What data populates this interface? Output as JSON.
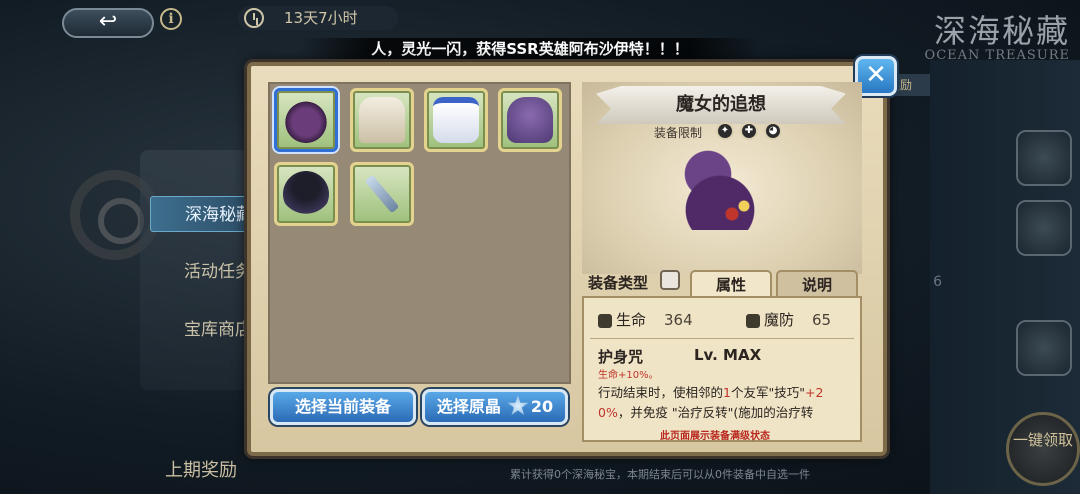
{
  "header": {
    "back_glyph": "↩",
    "info_glyph": "i",
    "timer": "13天7小时",
    "event_title_cn": "深海秘藏",
    "event_title_en": "OCEAN TREASURE"
  },
  "marquee": "人，灵光一闪，获得SSR英雄阿布沙伊特！！！",
  "background": {
    "tabs": [
      {
        "label": "深海秘藏",
        "active": true
      },
      {
        "label": "活动任务",
        "active": false
      },
      {
        "label": "宝库商店",
        "active": false
      }
    ],
    "last_reward": "上期奖励",
    "right_tab": "奖励",
    "right_number": "6",
    "one_click": "一键领取",
    "bottom_text": "累计获得0个深海秘宝，本期结束后可以从0件装备中自选一件"
  },
  "modal": {
    "header_tab": "上期奖励",
    "close_glyph": "✕",
    "inventory": [
      {
        "icon": "witch-hat-icon",
        "selected": true
      },
      {
        "icon": "white-robe-icon",
        "selected": false
      },
      {
        "icon": "white-crown-icon",
        "selected": false
      },
      {
        "icon": "purple-cape-icon",
        "selected": false
      },
      {
        "icon": "dark-cloak-icon",
        "selected": false
      },
      {
        "icon": "blue-sword-icon",
        "selected": false
      }
    ],
    "buttons": {
      "select_current": "选择当前装备",
      "select_original": "选择原晶",
      "original_cost": "20"
    },
    "detail": {
      "name": "魔女的追想",
      "restriction_label": "装备限制",
      "restriction_icons": [
        "staff-icon",
        "cross-icon",
        "cat-icon"
      ],
      "type_label": "装备类型",
      "tabs": [
        "属性",
        "说明"
      ],
      "stats": [
        {
          "icon": "heart-icon",
          "label": "生命",
          "value": "364"
        },
        {
          "icon": "shield-icon",
          "label": "魔防",
          "value": "65"
        }
      ],
      "skill_name": "护身咒",
      "skill_level": "Lv. MAX",
      "skill_line1": "生命+10%。",
      "skill_line2_a": "行动结束时，使相邻的",
      "skill_line2_hl": "1",
      "skill_line2_b": "个友军\"技巧\"",
      "skill_line2_hl2": "+2",
      "skill_line3_hl": "0%",
      "skill_line3_b": "，并免疫 \"治疗反转\"(施加的治疗转",
      "max_note": "此页面展示装备满级状态"
    }
  },
  "colors": {
    "accent_blue": "#2b6bb5",
    "highlight_red": "#c0352b",
    "panel_parchment": "#efe4c6"
  }
}
